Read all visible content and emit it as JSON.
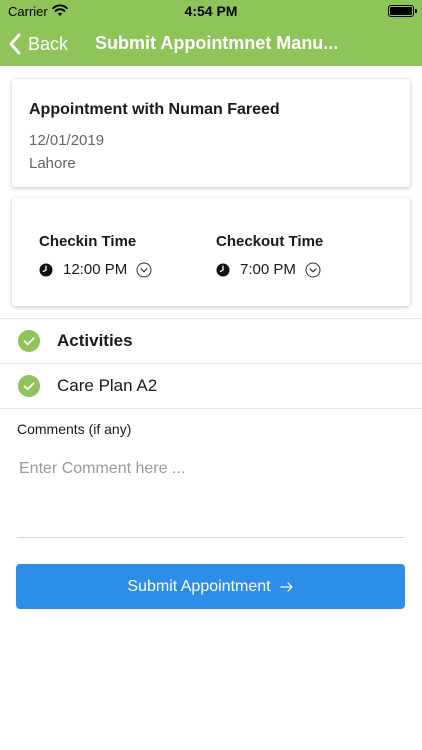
{
  "status_bar": {
    "carrier": "Carrier",
    "time": "4:54 PM"
  },
  "nav": {
    "back_label": "Back",
    "title": "Submit Appointmnet Manu..."
  },
  "appointment": {
    "title": "Appointment with Numan Fareed",
    "date": "12/01/2019",
    "location": "Lahore"
  },
  "times": {
    "checkin_label": "Checkin Time",
    "checkin_value": "12:00 PM",
    "checkout_label": "Checkout Time",
    "checkout_value": "7:00 PM"
  },
  "list": {
    "items": [
      {
        "label": "Activities",
        "checked": true
      },
      {
        "label": "Care Plan A2",
        "checked": true
      }
    ]
  },
  "comments": {
    "label": "Comments (if any)",
    "placeholder": "Enter Comment here ...",
    "value": ""
  },
  "submit": {
    "label": "Submit Appointment"
  },
  "colors": {
    "header": "#8fc45a",
    "check": "#8fc45a",
    "button": "#2d8ee8"
  },
  "icons": {
    "wifi": "wifi-icon",
    "battery": "battery-icon",
    "back": "chevron-left-icon",
    "clock": "clock-icon",
    "dropdown": "chevron-down-icon",
    "check": "check-circle-icon",
    "arrow": "arrow-right-icon"
  }
}
